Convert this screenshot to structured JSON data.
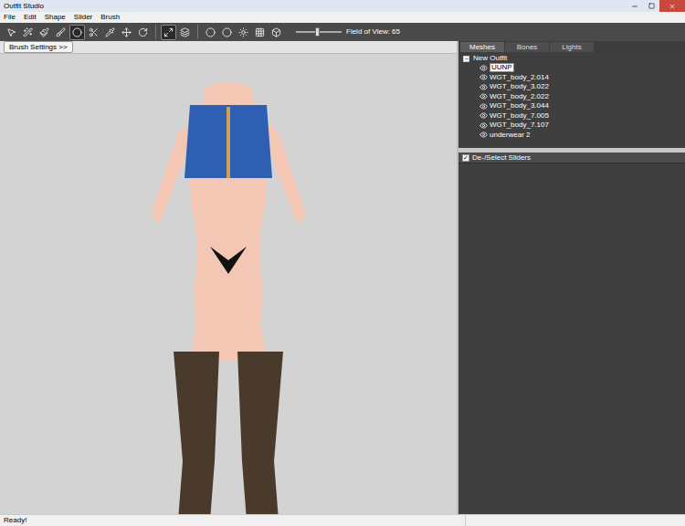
{
  "window": {
    "title": "Outfit Studio"
  },
  "menu": [
    "File",
    "Edit",
    "Shape",
    "Slider",
    "Brush"
  ],
  "toolbar": {
    "tools": [
      {
        "selected": false
      },
      {
        "selected": false
      },
      {
        "selected": false
      },
      {
        "selected": false
      },
      {
        "selected": true
      },
      {
        "selected": false
      },
      {
        "selected": false
      },
      {
        "selected": false
      },
      {
        "selected": false
      }
    ],
    "view_tools": [
      {
        "selected": true
      },
      {
        "selected": false
      }
    ],
    "display_tools": [
      {
        "selected": false
      },
      {
        "selected": false
      },
      {
        "selected": false
      },
      {
        "selected": false
      },
      {
        "selected": false
      }
    ],
    "fov_slider": {
      "level": 0.45
    },
    "fov_label": "Field of View: 65"
  },
  "brush_settings_button": "Brush Settings >>",
  "tabs": [
    {
      "label": "Meshes",
      "selected": true
    },
    {
      "label": "Bones",
      "selected": false
    },
    {
      "label": "Lights",
      "selected": false
    }
  ],
  "tree": {
    "root": {
      "label": "New Outfit",
      "expanded": true,
      "toggle": "−"
    },
    "items": [
      {
        "label": "UUNP",
        "visible": true,
        "selected": true
      },
      {
        "label": "WGT_body_2.014",
        "visible": true,
        "selected": false
      },
      {
        "label": "WGT_body_3.022",
        "visible": true,
        "selected": false
      },
      {
        "label": "WGT_body_2.022",
        "visible": true,
        "selected": false
      },
      {
        "label": "WGT_body_3.044",
        "visible": true,
        "selected": false
      },
      {
        "label": "WGT_body_7.005",
        "visible": true,
        "selected": false
      },
      {
        "label": "WGT_body_7.107",
        "visible": true,
        "selected": false
      },
      {
        "label": "underwear 2",
        "visible": true,
        "selected": false
      }
    ]
  },
  "sliders_header": {
    "label": "De-/Select Sliders",
    "checked": true
  },
  "status_bar": {
    "text": "Ready!"
  }
}
